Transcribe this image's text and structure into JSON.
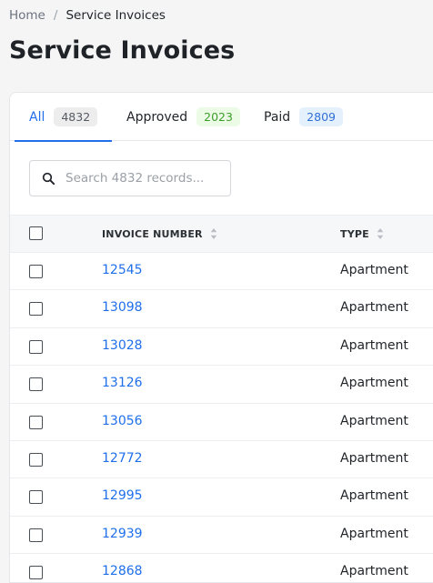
{
  "breadcrumb": {
    "home": "Home",
    "separator": "/",
    "current": "Service Invoices"
  },
  "page_title": "Service Invoices",
  "tabs": [
    {
      "label": "All",
      "count": "4832",
      "active": true
    },
    {
      "label": "Approved",
      "count": "2023",
      "active": false
    },
    {
      "label": "Paid",
      "count": "2809",
      "active": false
    }
  ],
  "search": {
    "placeholder": "Search 4832 records...",
    "icon": "search-icon"
  },
  "table": {
    "columns": [
      {
        "label": "INVOICE NUMBER",
        "sortable": true
      },
      {
        "label": "TYPE",
        "sortable": true
      }
    ],
    "rows": [
      {
        "invoice": "12545",
        "type": "Apartment"
      },
      {
        "invoice": "13098",
        "type": "Apartment"
      },
      {
        "invoice": "13028",
        "type": "Apartment"
      },
      {
        "invoice": "13126",
        "type": "Apartment"
      },
      {
        "invoice": "13056",
        "type": "Apartment"
      },
      {
        "invoice": "12772",
        "type": "Apartment"
      },
      {
        "invoice": "12995",
        "type": "Apartment"
      },
      {
        "invoice": "12939",
        "type": "Apartment"
      },
      {
        "invoice": "12868",
        "type": "Apartment"
      }
    ]
  },
  "colors": {
    "accent": "#1f6feb",
    "approved": "#3f9d2e",
    "paid": "#2f6fd6"
  }
}
